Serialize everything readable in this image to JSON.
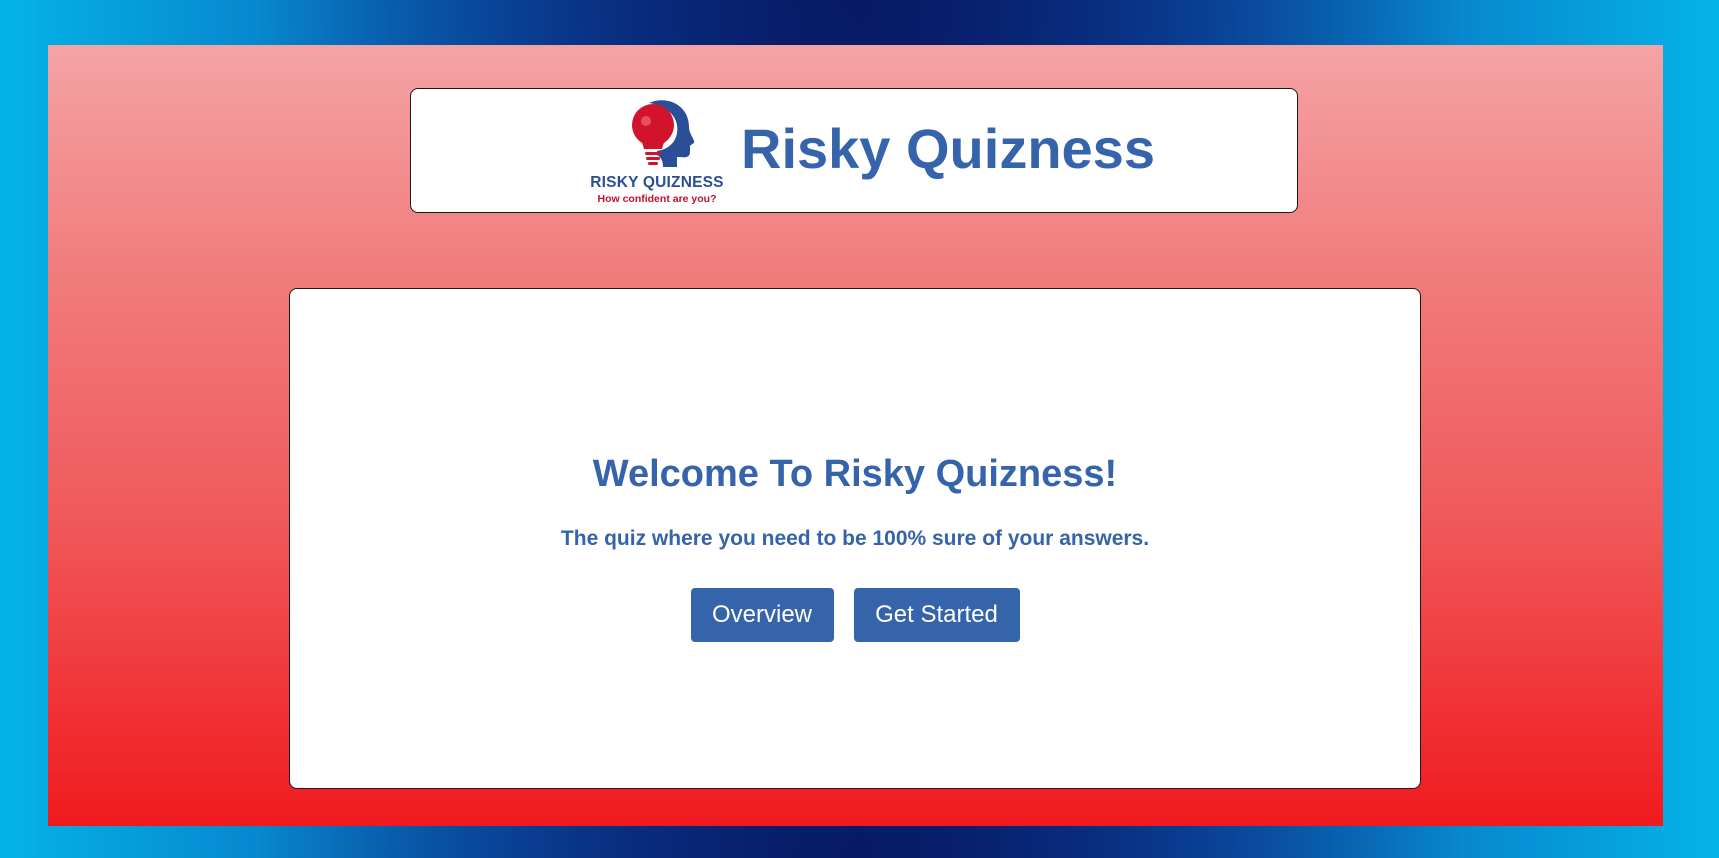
{
  "colors": {
    "brand_blue": "#3564ab",
    "brand_red": "#c0122b",
    "page_gradient_top": "#f4a3a5",
    "page_gradient_bottom": "#f01a1e",
    "card_background": "#ffffff"
  },
  "header": {
    "logo": {
      "icon": "head-lightbulb-icon",
      "text": "RISKY QUIZNESS",
      "tagline": "How confident are you?"
    },
    "title": "Risky Quizness"
  },
  "main": {
    "title": "Welcome To Risky Quizness!",
    "subtitle": "The quiz where you need to be 100% sure of your answers.",
    "buttons": {
      "overview_label": "Overview",
      "get_started_label": "Get Started"
    }
  }
}
